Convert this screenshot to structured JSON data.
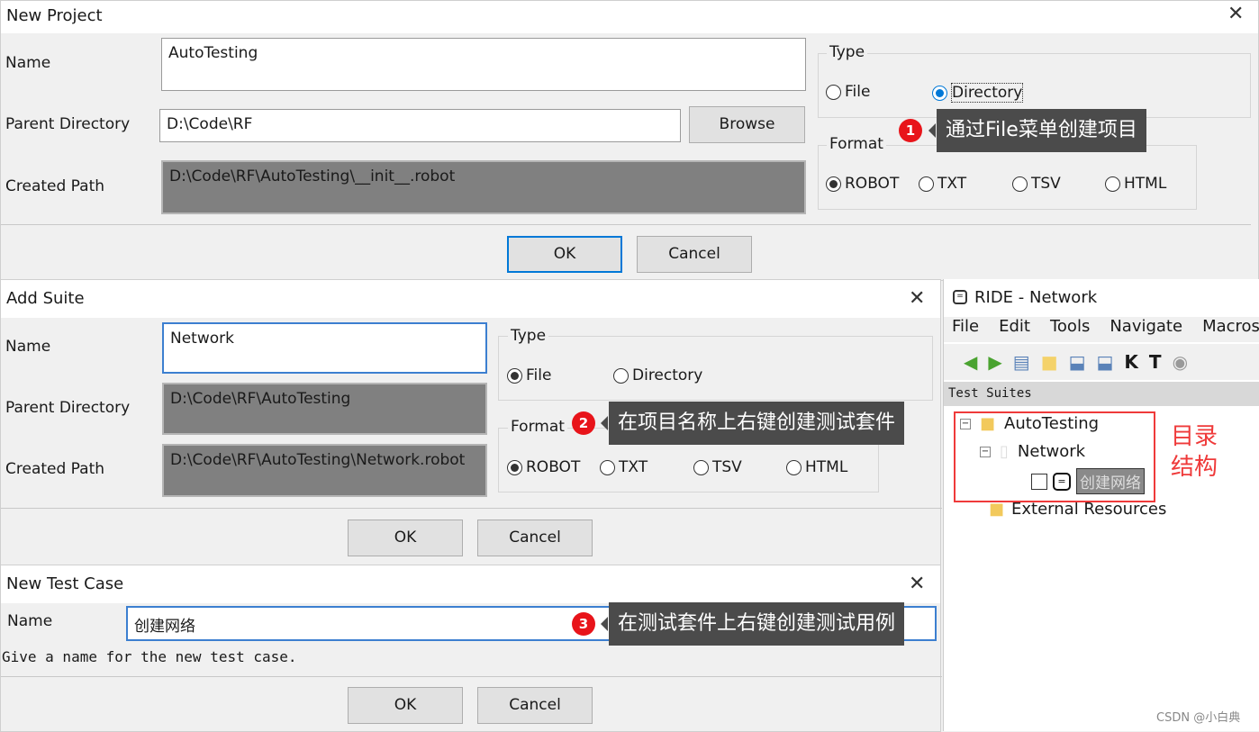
{
  "new_project": {
    "title": "New Project",
    "name_label": "Name",
    "name_value": "AutoTesting",
    "parent_label": "Parent Directory",
    "parent_value": "D:\\Code\\RF",
    "browse": "Browse",
    "created_label": "Created Path",
    "created_value": "D:\\Code\\RF\\AutoTesting\\__init__.robot",
    "type_label": "Type",
    "type_options": [
      "File",
      "Directory"
    ],
    "type_selected": "Directory",
    "format_label": "Format",
    "format_options": [
      "ROBOT",
      "TXT",
      "TSV",
      "HTML"
    ],
    "format_selected": "ROBOT",
    "ok": "OK",
    "cancel": "Cancel"
  },
  "add_suite": {
    "title": "Add Suite",
    "name_label": "Name",
    "name_value": "Network",
    "parent_label": "Parent Directory",
    "parent_value": "D:\\Code\\RF\\AutoTesting",
    "created_label": "Created Path",
    "created_value": "D:\\Code\\RF\\AutoTesting\\Network.robot",
    "type_label": "Type",
    "type_options": [
      "File",
      "Directory"
    ],
    "type_selected": "File",
    "format_label": "Format",
    "format_options": [
      "ROBOT",
      "TXT",
      "TSV",
      "HTML"
    ],
    "format_selected": "ROBOT",
    "ok": "OK",
    "cancel": "Cancel"
  },
  "new_test_case": {
    "title": "New Test Case",
    "name_label": "Name",
    "name_value": "创建网络",
    "hint": "Give a name for the new test case.",
    "ok": "OK",
    "cancel": "Cancel"
  },
  "callouts": [
    {
      "num": "1",
      "text": "通过File菜单创建项目"
    },
    {
      "num": "2",
      "text": "在项目名称上右键创建测试套件"
    },
    {
      "num": "3",
      "text": "在测试套件上右键创建测试用例"
    }
  ],
  "ride": {
    "title": "RIDE - Network",
    "menu": [
      "File",
      "Edit",
      "Tools",
      "Navigate",
      "Macros"
    ],
    "panel_title": "Test Suites",
    "tree": {
      "root": "AutoTesting",
      "suite": "Network",
      "test": "创建网络",
      "external": "External Resources"
    },
    "annotation": "目录\n结构"
  },
  "watermark": "CSDN @小白典",
  "colors": {
    "callout_bg": "#4b4b4b",
    "badge": "#e8141a",
    "highlight": "#0078d7"
  }
}
